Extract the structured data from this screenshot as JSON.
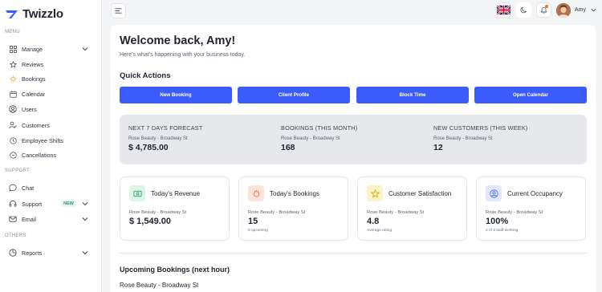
{
  "app": {
    "name": "Twizzlo",
    "brand_color": "#3b5bfd"
  },
  "sidebar": {
    "menu_label": "MENU",
    "support_label": "SUPPORT",
    "others_label": "OTHERS",
    "items": [
      {
        "label": "Manage",
        "icon": "grid-icon"
      },
      {
        "label": "Reviews",
        "icon": "star-icon"
      },
      {
        "label": "Bookings",
        "icon": "sun-icon"
      },
      {
        "label": "Calendar",
        "icon": "calendar-icon"
      },
      {
        "label": "Users",
        "icon": "user-circle-icon"
      },
      {
        "label": "Customers",
        "icon": "customers-icon"
      },
      {
        "label": "Employee Shifts",
        "icon": "clock-icon"
      },
      {
        "label": "Cancellations",
        "icon": "cancel-icon"
      },
      {
        "label": "Chat",
        "icon": "chat-icon"
      },
      {
        "label": "Support",
        "icon": "support-icon",
        "badge": "NEW"
      },
      {
        "label": "Email",
        "icon": "mail-icon"
      },
      {
        "label": "Reports",
        "icon": "reports-icon"
      }
    ]
  },
  "topbar": {
    "user_name": "Amy",
    "notification_color": "#f97316"
  },
  "main": {
    "welcome": "Welcome back, Amy!",
    "subtitle": "Here's what's happening with your business today.",
    "quick_actions_title": "Quick Actions",
    "quick_actions": [
      "New Booking",
      "Client Profile",
      "Block Time",
      "Open Calendar"
    ],
    "forecast": [
      {
        "title": "NEXT 7 DAYS FORECAST",
        "location": "Rose Beauty - Broadway St",
        "value": "$ 4,785.00"
      },
      {
        "title": "BOOKINGS (THIS MONTH)",
        "location": "Rose Beauty - Broadway St",
        "value": "168"
      },
      {
        "title": "NEW CUSTOMERS (THIS WEEK)",
        "location": "Rose Beauty - Broadway St",
        "value": "12"
      }
    ],
    "cards": [
      {
        "title": "Today's Revenue",
        "location": "Rose Beauty - Broadway St",
        "value": "$ 1,549.00",
        "note": "",
        "icon": "money-icon",
        "icon_bg": "#dcf5e5",
        "icon_color": "#22a06b"
      },
      {
        "title": "Today's Bookings",
        "location": "Rose Beauty - Broadway St",
        "value": "15",
        "note": "6 upcoming",
        "icon": "bookings-icon",
        "icon_bg": "#fde4da",
        "icon_color": "#f0703c"
      },
      {
        "title": "Customer Satisfaction",
        "location": "Rose Beauty - Broadway St",
        "value": "4.8",
        "note": "Average rating",
        "icon": "star-icon",
        "icon_bg": "#fbf4c6",
        "icon_color": "#d9a800"
      },
      {
        "title": "Current Occupancy",
        "location": "Rose Beauty - Broadway St",
        "value": "100%",
        "note": "2 of 2 staff working",
        "icon": "user-icon",
        "icon_bg": "#e0e7ff",
        "icon_color": "#4f6bf0"
      }
    ],
    "upcoming_title": "Upcoming Bookings (next hour)",
    "upcoming_location": "Rose Beauty - Broadway St"
  }
}
